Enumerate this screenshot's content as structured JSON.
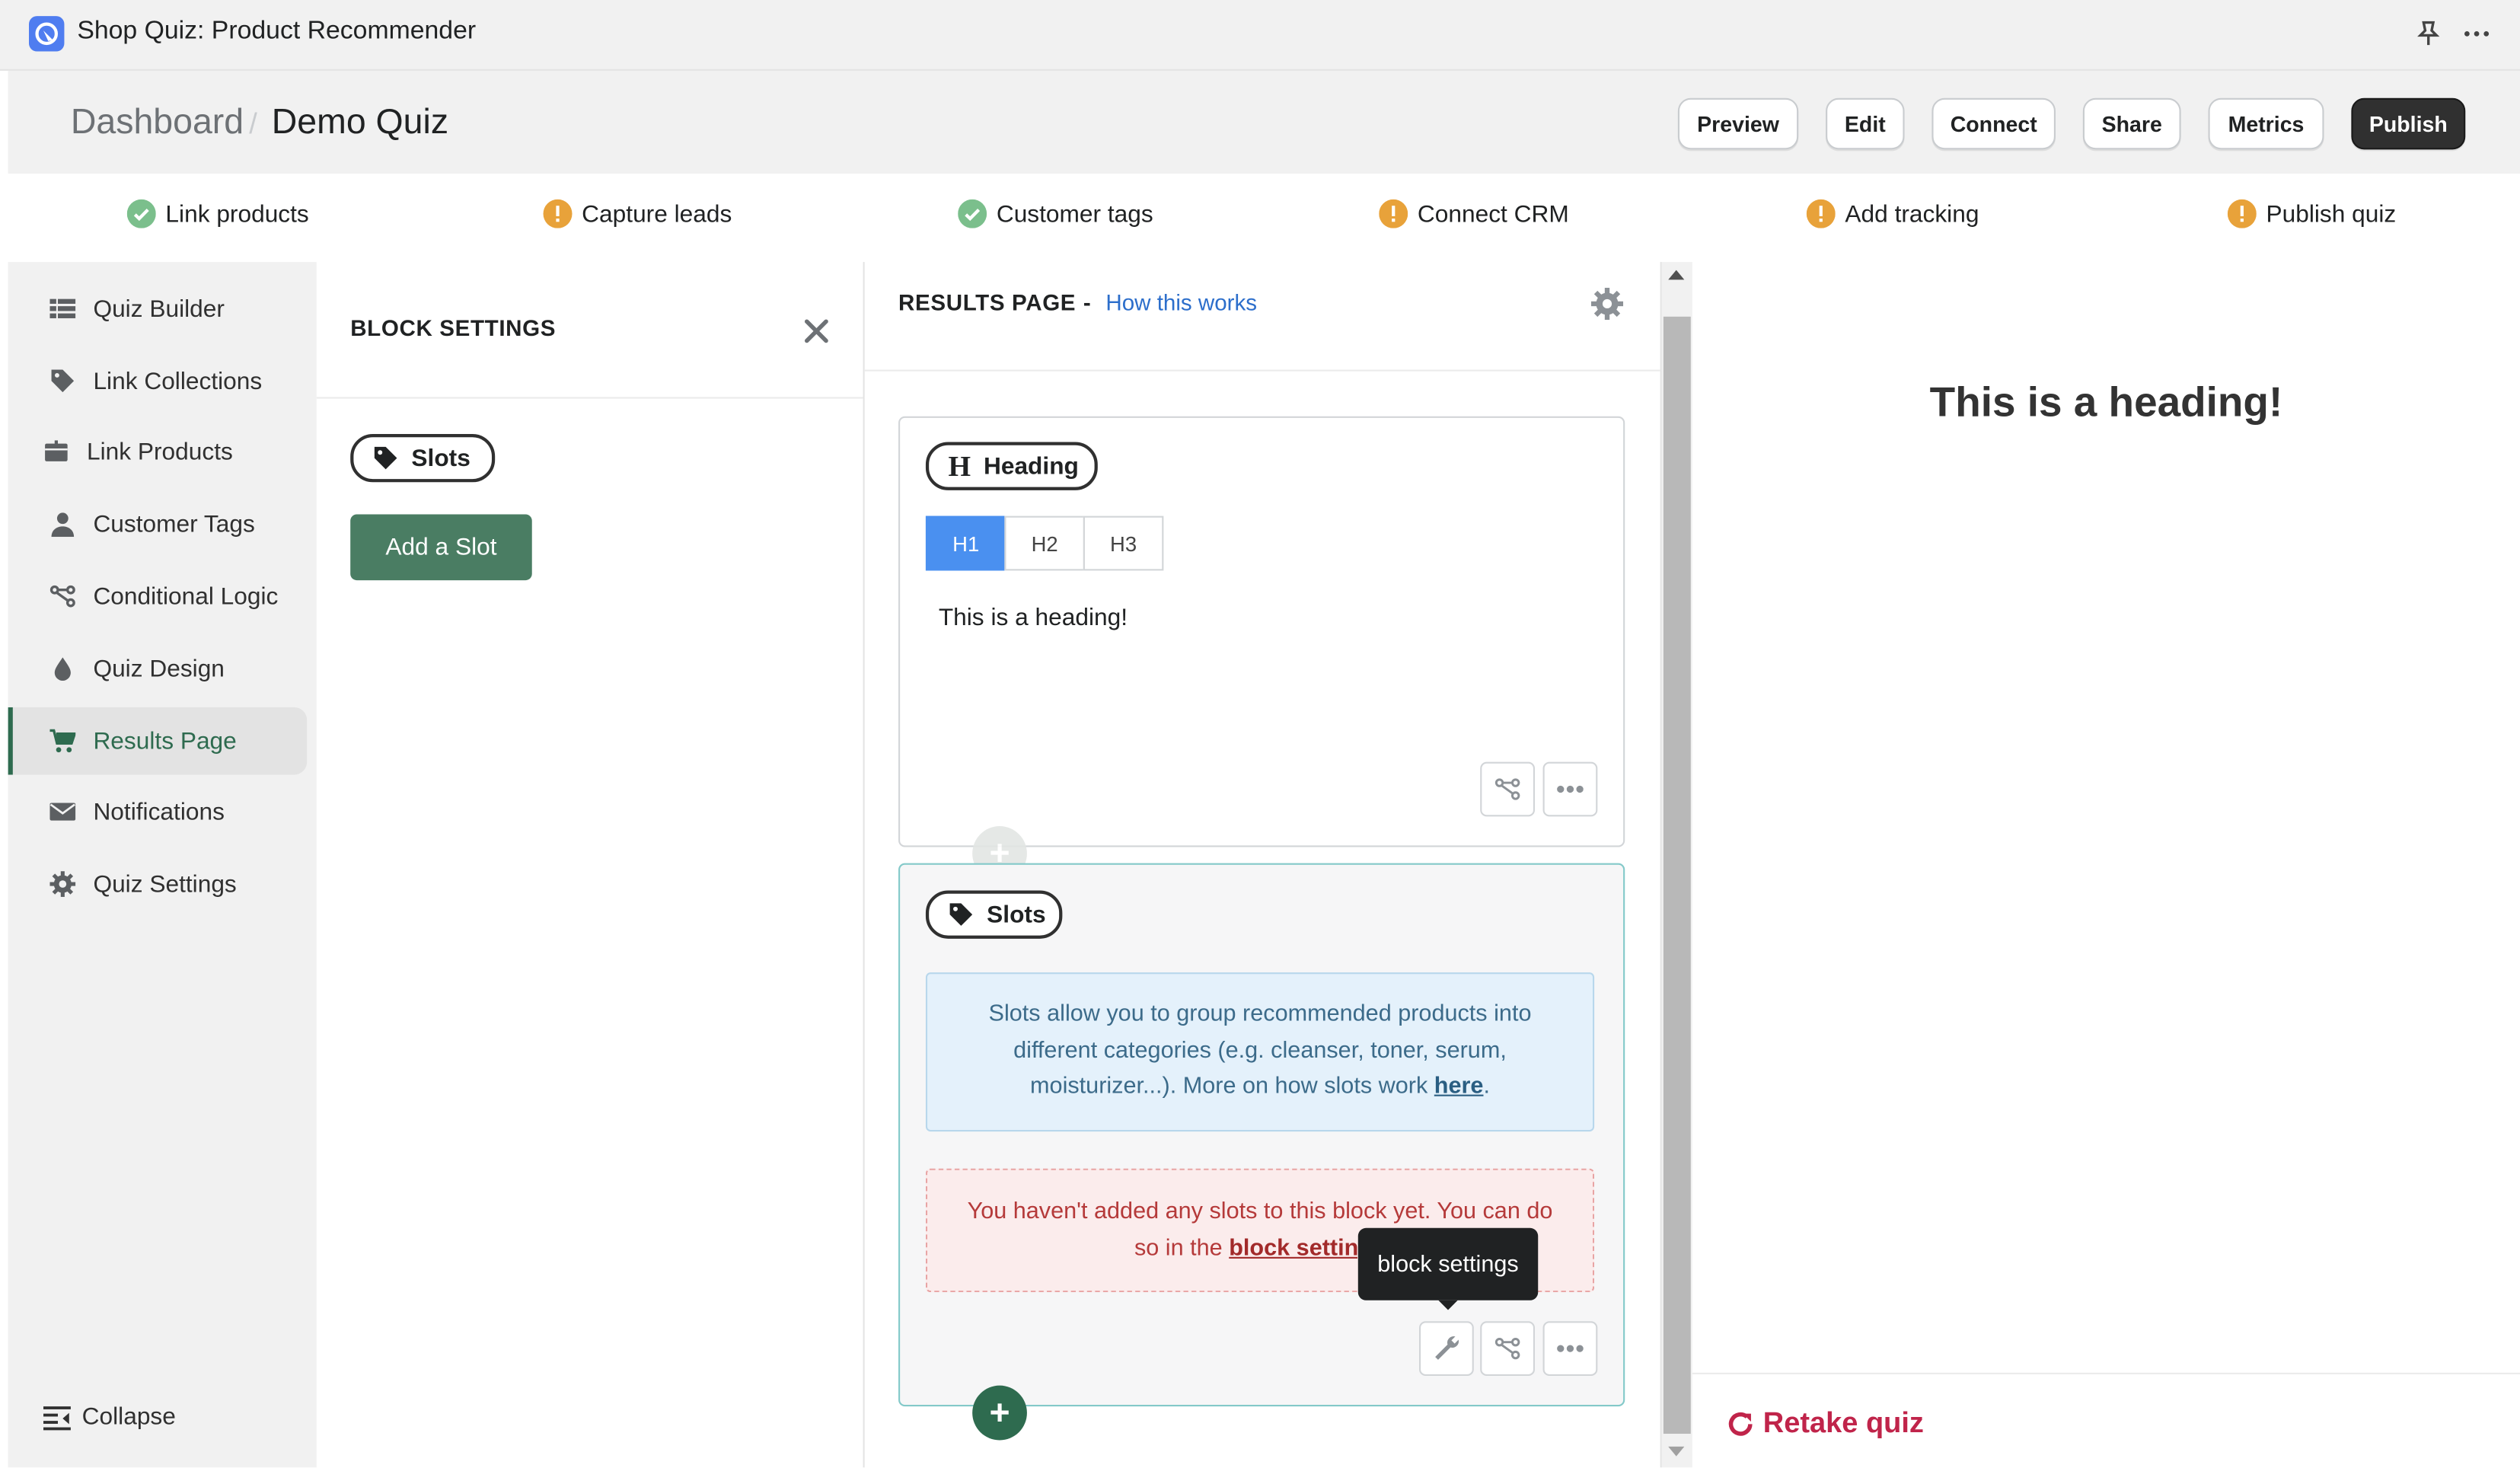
{
  "window": {
    "title": "Shop Quiz: Product Recommender"
  },
  "breadcrumb": {
    "root": "Dashboard",
    "separator": "/",
    "current": "Demo Quiz"
  },
  "header_buttons": [
    "Preview",
    "Edit",
    "Connect",
    "Share",
    "Metrics",
    "Publish"
  ],
  "checklist": [
    {
      "label": "Link products",
      "status": "done",
      "icon": "check-circle-icon"
    },
    {
      "label": "Capture leads",
      "status": "warning",
      "icon": "alert-circle-icon"
    },
    {
      "label": "Customer tags",
      "status": "done",
      "icon": "check-circle-icon"
    },
    {
      "label": "Connect CRM",
      "status": "warning",
      "icon": "alert-circle-icon"
    },
    {
      "label": "Add tracking",
      "status": "warning",
      "icon": "alert-circle-icon"
    },
    {
      "label": "Publish quiz",
      "status": "warning",
      "icon": "alert-circle-icon"
    }
  ],
  "sidebar": {
    "items": [
      {
        "label": "Quiz Builder",
        "icon": "list-icon"
      },
      {
        "label": "Link Collections",
        "icon": "tag-icon"
      },
      {
        "label": "Link Products",
        "icon": "box-icon"
      },
      {
        "label": "Customer Tags",
        "icon": "user-icon"
      },
      {
        "label": "Conditional Logic",
        "icon": "branch-icon"
      },
      {
        "label": "Quiz Design",
        "icon": "droplet-icon"
      },
      {
        "label": "Results Page",
        "icon": "cart-icon",
        "active": true
      },
      {
        "label": "Notifications",
        "icon": "envelope-icon"
      },
      {
        "label": "Quiz Settings",
        "icon": "gear-icon"
      }
    ],
    "collapse_label": "Collapse"
  },
  "block_settings": {
    "title": "BLOCK SETTINGS",
    "pill_label": "Slots",
    "add_button": "Add a Slot"
  },
  "results_page": {
    "title": "RESULTS PAGE",
    "dash": "-",
    "help_link": "How this works",
    "heading_block": {
      "pill_label": "Heading",
      "levels": [
        "H1",
        "H2",
        "H3"
      ],
      "selected_level": "H1",
      "text": "This is a heading!"
    },
    "slots_block": {
      "pill_label": "Slots",
      "info_text": "Slots allow you to group recommended products into different categories (e.g. cleanser, toner, serum, moisturizer...). More on how slots work",
      "info_link": "here",
      "info_end": ".",
      "error_text": "You haven't added any slots to this block yet. You can do so in the",
      "error_link": "block settings",
      "tooltip": "block settings"
    }
  },
  "preview": {
    "heading": "This is a heading!",
    "retake_label": "Retake quiz"
  },
  "colors": {
    "accent_green": "#4a7d63",
    "selected_blue": "#4a90f0",
    "warning_orange": "#e8a23a",
    "done_green": "#7bbf8c",
    "retake_red": "#c0244a"
  }
}
